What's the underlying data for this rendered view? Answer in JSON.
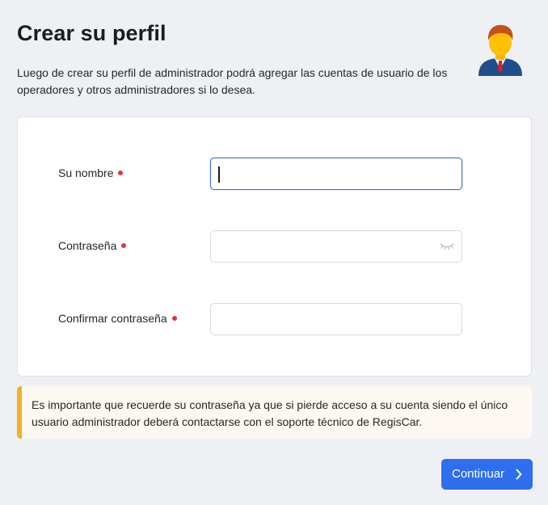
{
  "header": {
    "title": "Crear su perfil",
    "intro": "Luego de crear su perfil de administrador podrá agregar las cuentas de usuario de los operadores y otros administradores si lo desea.",
    "avatar_icon": "businessman-avatar-icon"
  },
  "form": {
    "fields": [
      {
        "label": "Su nombre",
        "value": "",
        "required": true,
        "focused": true
      },
      {
        "label": "Contraseña",
        "value": "",
        "required": true,
        "icon": "eye-closed-icon"
      },
      {
        "label": "Confirmar contraseña",
        "value": "",
        "required": true
      }
    ]
  },
  "notice": {
    "text": "Es importante que recuerde su contraseña ya que si pierde acceso a su cuenta siendo el único usuario administrador deberá contactarse con el soporte técnico de RegisCar.",
    "accent_color": "#f0b323"
  },
  "actions": {
    "continue_label": "Continuar",
    "continue_icon": "chevron-right-icon",
    "primary_color": "#2f6fef"
  },
  "colors": {
    "required_dot": "#e0344a",
    "focus_border": "#3d6ed8",
    "background": "#eef0f4"
  }
}
